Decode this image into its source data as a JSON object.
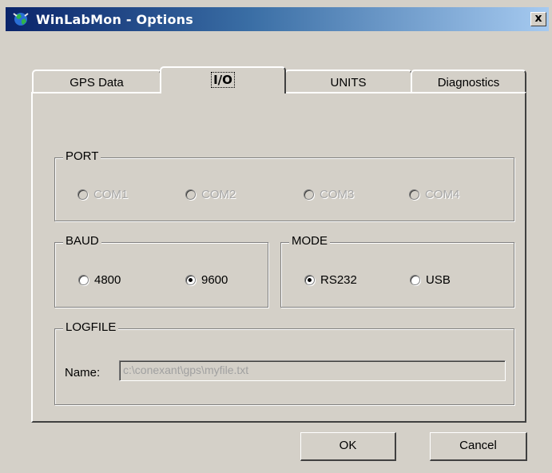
{
  "window": {
    "title": "WinLabMon - Options",
    "close_glyph": "x"
  },
  "tabs": [
    {
      "label": "GPS Data",
      "active": false
    },
    {
      "label": "I/O",
      "active": true
    },
    {
      "label": "UNITS",
      "active": false
    },
    {
      "label": "Diagnostics",
      "active": false
    }
  ],
  "port": {
    "legend": "PORT",
    "options": [
      {
        "label": "COM1",
        "checked": false,
        "disabled": true
      },
      {
        "label": "COM2",
        "checked": false,
        "disabled": true
      },
      {
        "label": "COM3",
        "checked": false,
        "disabled": true
      },
      {
        "label": "COM4",
        "checked": false,
        "disabled": true
      }
    ]
  },
  "baud": {
    "legend": "BAUD",
    "options": [
      {
        "label": "4800",
        "checked": false
      },
      {
        "label": "9600",
        "checked": true
      }
    ]
  },
  "mode": {
    "legend": "MODE",
    "options": [
      {
        "label": "RS232",
        "checked": true
      },
      {
        "label": "USB",
        "checked": false
      }
    ]
  },
  "logfile": {
    "legend": "LOGFILE",
    "name_label": "Name:",
    "name_value": "c:\\conexant\\gps\\myfile.txt"
  },
  "buttons": {
    "ok": "OK",
    "cancel": "Cancel"
  }
}
